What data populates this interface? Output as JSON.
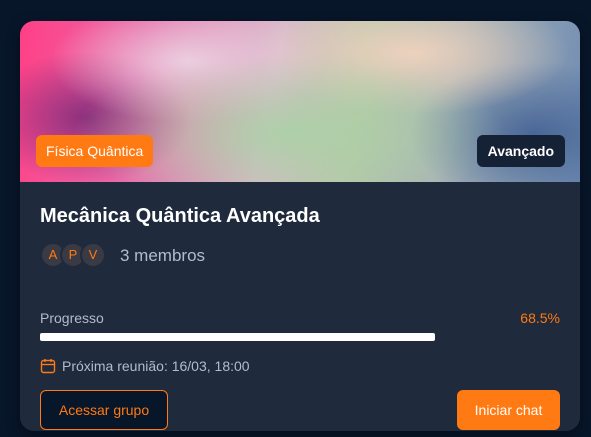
{
  "card": {
    "category_badge": "Física Quântica",
    "level_badge": "Avançado",
    "title": "Mecânica Quântica Avançada",
    "avatars": [
      "A",
      "P",
      "V"
    ],
    "members_text": "3 membros",
    "progress": {
      "label": "Progresso",
      "value_text": "68.5%",
      "fraction": 0.76
    },
    "next_meeting": {
      "icon": "calendar-icon",
      "text": "Próxima reunião: 16/03, 18:00"
    },
    "buttons": {
      "access_label": "Acessar grupo",
      "chat_label": "Iniciar chat"
    }
  },
  "colors": {
    "accent": "#ff7a12",
    "card_bg": "#1f2a3c",
    "page_bg": "#08162a",
    "text_primary": "#ffffff",
    "text_muted": "#b4bccb"
  }
}
